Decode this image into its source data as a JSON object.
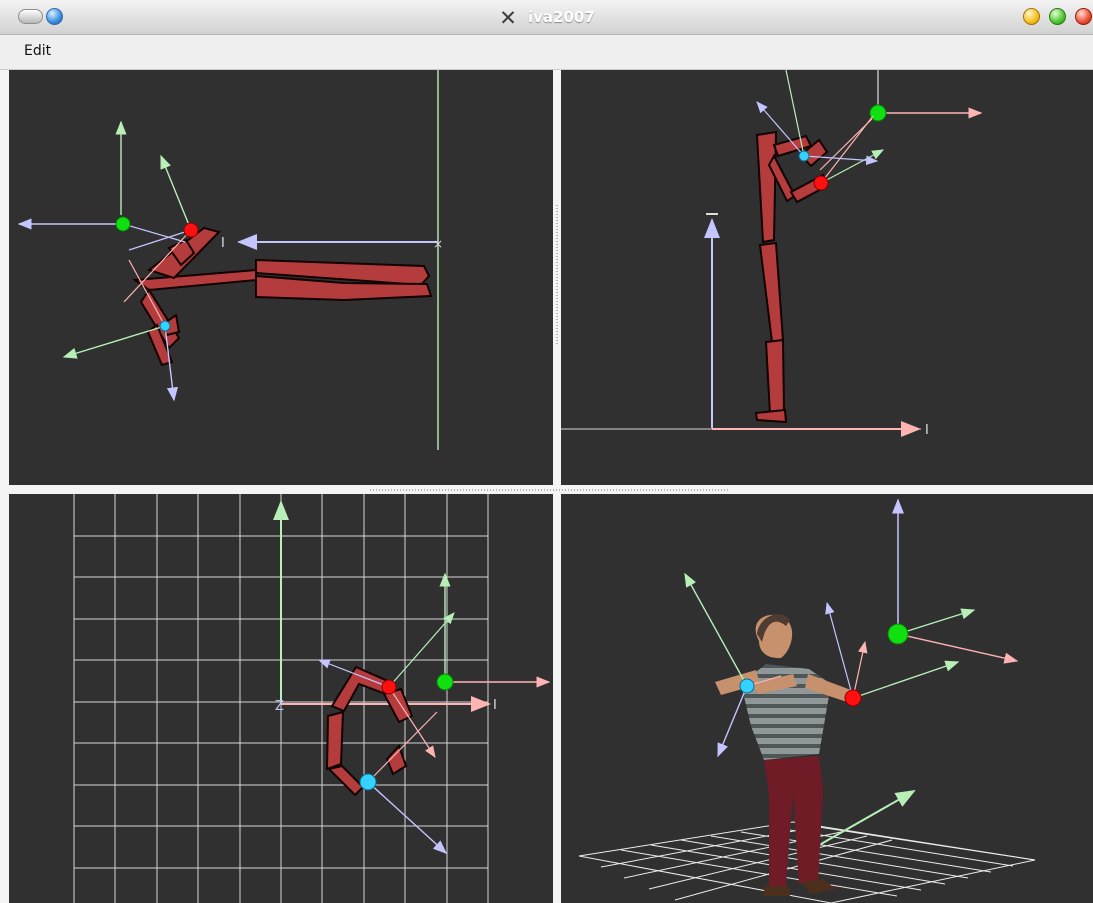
{
  "window": {
    "title": "iva2007",
    "logo": "x-logo-icon",
    "buttons": [
      "shade",
      "sticky",
      "minimize",
      "maximize",
      "close"
    ]
  },
  "menu": {
    "items": [
      {
        "label": "Edit"
      }
    ]
  },
  "viewports": [
    {
      "name": "top-view",
      "axis_labels": [
        "I"
      ]
    },
    {
      "name": "side-view",
      "axis_labels": [
        "I"
      ]
    },
    {
      "name": "front-view",
      "axis_labels": [
        "Z",
        "I"
      ]
    },
    {
      "name": "perspective-view",
      "axis_labels": []
    }
  ],
  "colors": {
    "viewport_background": "#303030",
    "axis_red": "#ffb4b4",
    "axis_green": "#b7efb7",
    "axis_blue": "#c4c4ff",
    "skeleton_red": "#b43c3c",
    "handle_red": "#ff1010",
    "handle_green": "#10e010",
    "handle_cyan": "#35d2ff"
  }
}
